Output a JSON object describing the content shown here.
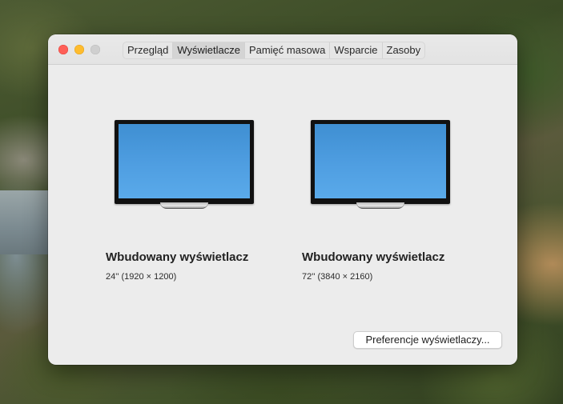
{
  "window": {
    "tabs": [
      {
        "label": "Przegląd",
        "active": false
      },
      {
        "label": "Wyświetlacze",
        "active": true
      },
      {
        "label": "Pamięć masowa",
        "active": false
      },
      {
        "label": "Wsparcie",
        "active": false
      },
      {
        "label": "Zasoby",
        "active": false
      }
    ],
    "traffic_lights": {
      "close": "#fe5f57",
      "minimize": "#febc2e",
      "zoom": "#cfcfcf"
    }
  },
  "displays": [
    {
      "name": "Wbudowany wyświetlacz",
      "spec": "24'' (1920 × 1200)",
      "icon": "monitor-icon"
    },
    {
      "name": "Wbudowany wyświetlacz",
      "spec": "72'' (3840 × 2160)",
      "icon": "monitor-icon"
    }
  ],
  "footer": {
    "preferences_button": "Preferencje wyświetlaczy..."
  },
  "colors": {
    "screen_blue": "#4f9ee1",
    "window_bg": "#ececec"
  }
}
